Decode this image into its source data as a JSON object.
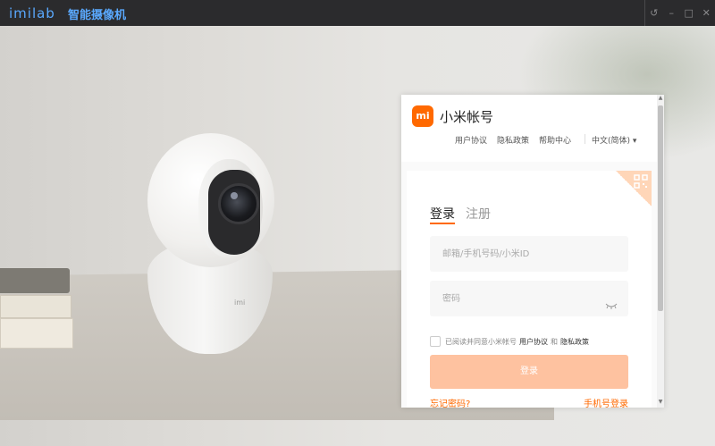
{
  "titlebar": {
    "logo_text": "imilab",
    "app_name": "智能摄像机",
    "controls": {
      "restore_icon": "↺",
      "minimize_icon": "–",
      "maximize_icon": "□",
      "close_icon": "✕"
    }
  },
  "camera": {
    "brand": "imi"
  },
  "login": {
    "mi_logo": "mi",
    "title": "小米帐号",
    "links": [
      "用户协议",
      "隐私政策",
      "帮助中心"
    ],
    "language": "中文(简体) ▾",
    "tabs": {
      "login": "登录",
      "register": "注册"
    },
    "account_placeholder": "邮箱/手机号码/小米ID",
    "password_placeholder": "密码",
    "agreement": {
      "prefix": "已阅读并同意小米帐号",
      "user_agreement": "用户协议",
      "and": "和",
      "privacy_policy": "隐私政策"
    },
    "login_button": "登录",
    "forgot_password": "忘记密码?",
    "phone_login": "手机号登录"
  },
  "colors": {
    "accent": "#ff6900",
    "button_disabled": "#fec2a0",
    "titlebar_bg": "#2b2b2d",
    "logo_blue": "#5aa9ff"
  }
}
